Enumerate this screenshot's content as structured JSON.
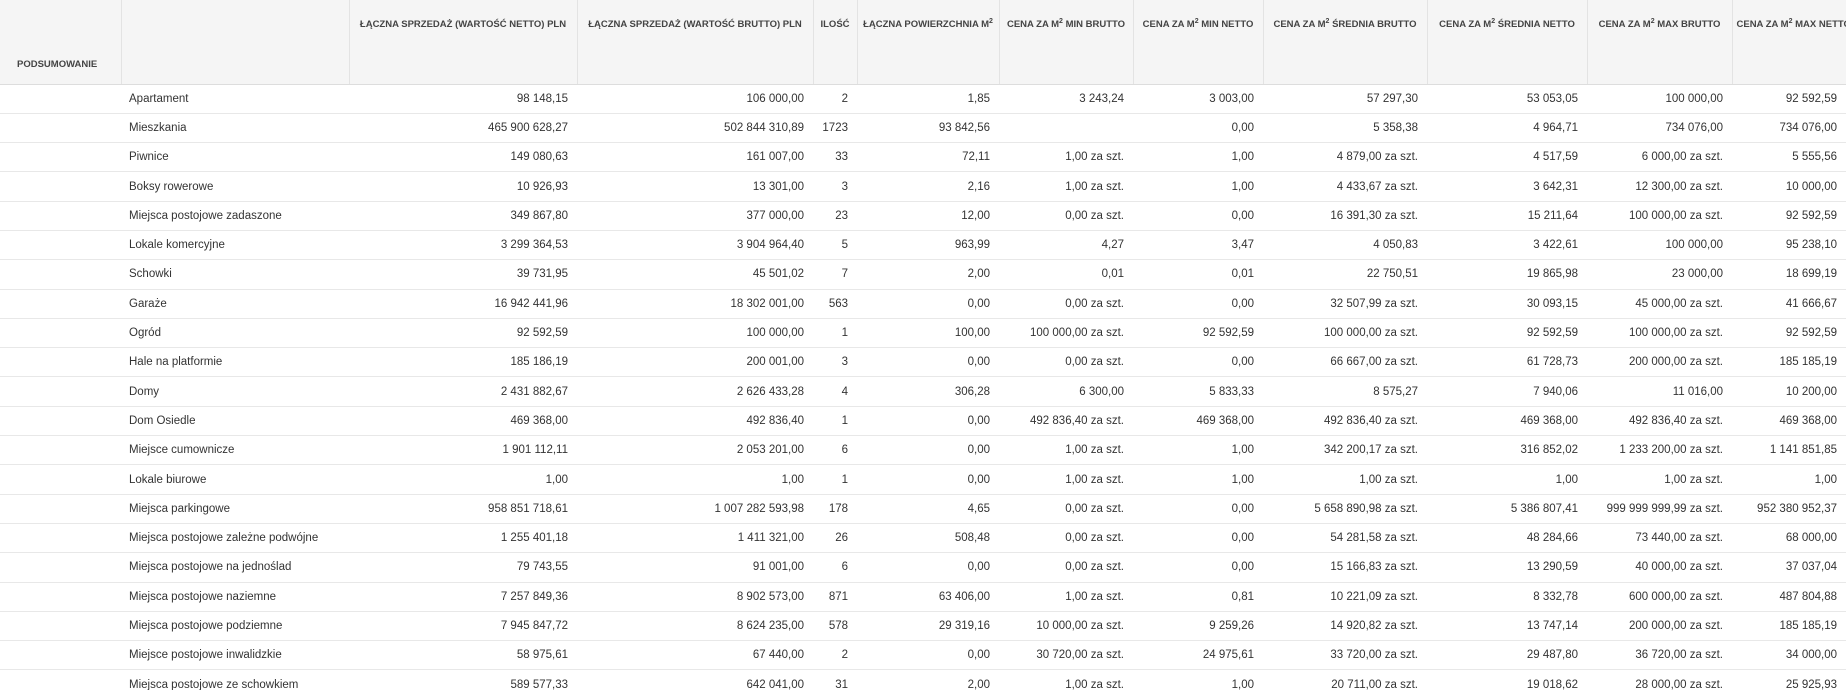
{
  "summary_label": "PODSUMOWANIE",
  "columns": [
    {
      "pre": "ŁĄCZNA SPRZEDAŻ (WARTOŚĆ NETTO) PLN",
      "sup": "",
      "post": ""
    },
    {
      "pre": "ŁĄCZNA SPRZEDAŻ (WARTOŚĆ BRUTTO) PLN",
      "sup": "",
      "post": ""
    },
    {
      "pre": "ILOŚĆ",
      "sup": "",
      "post": ""
    },
    {
      "pre": "ŁĄCZNA POWIERZCHNIA M",
      "sup": "2",
      "post": ""
    },
    {
      "pre": "CENA ZA M",
      "sup": "2",
      "post": " MIN BRUTTO"
    },
    {
      "pre": "CENA ZA M",
      "sup": "2",
      "post": " MIN NETTO"
    },
    {
      "pre": "CENA ZA M",
      "sup": "2",
      "post": " ŚREDNIA BRUTTO"
    },
    {
      "pre": "CENA ZA M",
      "sup": "2",
      "post": " ŚREDNIA NETTO"
    },
    {
      "pre": "CENA ZA M",
      "sup": "2",
      "post": " MAX BRUTTO"
    },
    {
      "pre": "CENA ZA M",
      "sup": "2",
      "post": " MAX NETTO"
    }
  ],
  "rows": [
    {
      "name": "Apartament",
      "values": [
        "98 148,15",
        "106 000,00",
        "2",
        "1,85",
        "3 243,24",
        "3 003,00",
        "57 297,30",
        "53 053,05",
        "100 000,00",
        "92 592,59"
      ]
    },
    {
      "name": "Mieszkania",
      "values": [
        "465 900 628,27",
        "502 844 310,89",
        "1723",
        "93 842,56",
        "",
        "0,00",
        "5 358,38",
        "4 964,71",
        "734 076,00",
        "734 076,00"
      ]
    },
    {
      "name": "Piwnice",
      "values": [
        "149 080,63",
        "161 007,00",
        "33",
        "72,11",
        "1,00 za szt.",
        "1,00",
        "4 879,00 za szt.",
        "4 517,59",
        "6 000,00 za szt.",
        "5 555,56"
      ]
    },
    {
      "name": "Boksy rowerowe",
      "values": [
        "10 926,93",
        "13 301,00",
        "3",
        "2,16",
        "1,00 za szt.",
        "1,00",
        "4 433,67 za szt.",
        "3 642,31",
        "12 300,00 za szt.",
        "10 000,00"
      ]
    },
    {
      "name": "Miejsca postojowe zadaszone",
      "values": [
        "349 867,80",
        "377 000,00",
        "23",
        "12,00",
        "0,00 za szt.",
        "0,00",
        "16 391,30 za szt.",
        "15 211,64",
        "100 000,00 za szt.",
        "92 592,59"
      ]
    },
    {
      "name": "Lokale komercyjne",
      "values": [
        "3 299 364,53",
        "3 904 964,40",
        "5",
        "963,99",
        "4,27",
        "3,47",
        "4 050,83",
        "3 422,61",
        "100 000,00",
        "95 238,10"
      ]
    },
    {
      "name": "Schowki",
      "values": [
        "39 731,95",
        "45 501,02",
        "7",
        "2,00",
        "0,01",
        "0,01",
        "22 750,51",
        "19 865,98",
        "23 000,00",
        "18 699,19"
      ]
    },
    {
      "name": "Garaże",
      "values": [
        "16 942 441,96",
        "18 302 001,00",
        "563",
        "0,00",
        "0,00 za szt.",
        "0,00",
        "32 507,99 za szt.",
        "30 093,15",
        "45 000,00 za szt.",
        "41 666,67"
      ]
    },
    {
      "name": "Ogród",
      "values": [
        "92 592,59",
        "100 000,00",
        "1",
        "100,00",
        "100 000,00 za szt.",
        "92 592,59",
        "100 000,00 za szt.",
        "92 592,59",
        "100 000,00 za szt.",
        "92 592,59"
      ]
    },
    {
      "name": "Hale na platformie",
      "values": [
        "185 186,19",
        "200 001,00",
        "3",
        "0,00",
        "0,00 za szt.",
        "0,00",
        "66 667,00 za szt.",
        "61 728,73",
        "200 000,00 za szt.",
        "185 185,19"
      ]
    },
    {
      "name": "Domy",
      "values": [
        "2 431 882,67",
        "2 626 433,28",
        "4",
        "306,28",
        "6 300,00",
        "5 833,33",
        "8 575,27",
        "7 940,06",
        "11 016,00",
        "10 200,00"
      ]
    },
    {
      "name": "Dom Osiedle",
      "values": [
        "469 368,00",
        "492 836,40",
        "1",
        "0,00",
        "492 836,40 za szt.",
        "469 368,00",
        "492 836,40 za szt.",
        "469 368,00",
        "492 836,40 za szt.",
        "469 368,00"
      ]
    },
    {
      "name": "Miejsce cumownicze",
      "values": [
        "1 901 112,11",
        "2 053 201,00",
        "6",
        "0,00",
        "1,00 za szt.",
        "1,00",
        "342 200,17 za szt.",
        "316 852,02",
        "1 233 200,00 za szt.",
        "1 141 851,85"
      ]
    },
    {
      "name": "Lokale biurowe",
      "values": [
        "1,00",
        "1,00",
        "1",
        "0,00",
        "1,00 za szt.",
        "1,00",
        "1,00 za szt.",
        "1,00",
        "1,00 za szt.",
        "1,00"
      ]
    },
    {
      "name": "Miejsca parkingowe",
      "values": [
        "958 851 718,61",
        "1 007 282 593,98",
        "178",
        "4,65",
        "0,00 za szt.",
        "0,00",
        "5 658 890,98 za szt.",
        "5 386 807,41",
        "999 999 999,99 za szt.",
        "952 380 952,37"
      ]
    },
    {
      "name": "Miejsca postojowe zależne podwójne",
      "values": [
        "1 255 401,18",
        "1 411 321,00",
        "26",
        "508,48",
        "0,00 za szt.",
        "0,00",
        "54 281,58 za szt.",
        "48 284,66",
        "73 440,00 za szt.",
        "68 000,00"
      ]
    },
    {
      "name": "Miejsca postojowe na jednoślad",
      "values": [
        "79 743,55",
        "91 001,00",
        "6",
        "0,00",
        "0,00 za szt.",
        "0,00",
        "15 166,83 za szt.",
        "13 290,59",
        "40 000,00 za szt.",
        "37 037,04"
      ]
    },
    {
      "name": "Miejsca postojowe naziemne",
      "values": [
        "7 257 849,36",
        "8 902 573,00",
        "871",
        "63 406,00",
        "1,00 za szt.",
        "0,81",
        "10 221,09 za szt.",
        "8 332,78",
        "600 000,00 za szt.",
        "487 804,88"
      ]
    },
    {
      "name": "Miejsca postojowe podziemne",
      "values": [
        "7 945 847,72",
        "8 624 235,00",
        "578",
        "29 319,16",
        "10 000,00 za szt.",
        "9 259,26",
        "14 920,82 za szt.",
        "13 747,14",
        "200 000,00 za szt.",
        "185 185,19"
      ]
    },
    {
      "name": "Miejsce postojowe inwalidzkie",
      "values": [
        "58 975,61",
        "67 440,00",
        "2",
        "0,00",
        "30 720,00 za szt.",
        "24 975,61",
        "33 720,00 za szt.",
        "29 487,80",
        "36 720,00 za szt.",
        "34 000,00"
      ]
    },
    {
      "name": "Miejsca postojowe ze schowkiem",
      "values": [
        "589 577,33",
        "642 041,00",
        "31",
        "2,00",
        "1,00 za szt.",
        "1,00",
        "20 711,00 za szt.",
        "19 018,62",
        "28 000,00 za szt.",
        "25 925,93"
      ]
    }
  ]
}
